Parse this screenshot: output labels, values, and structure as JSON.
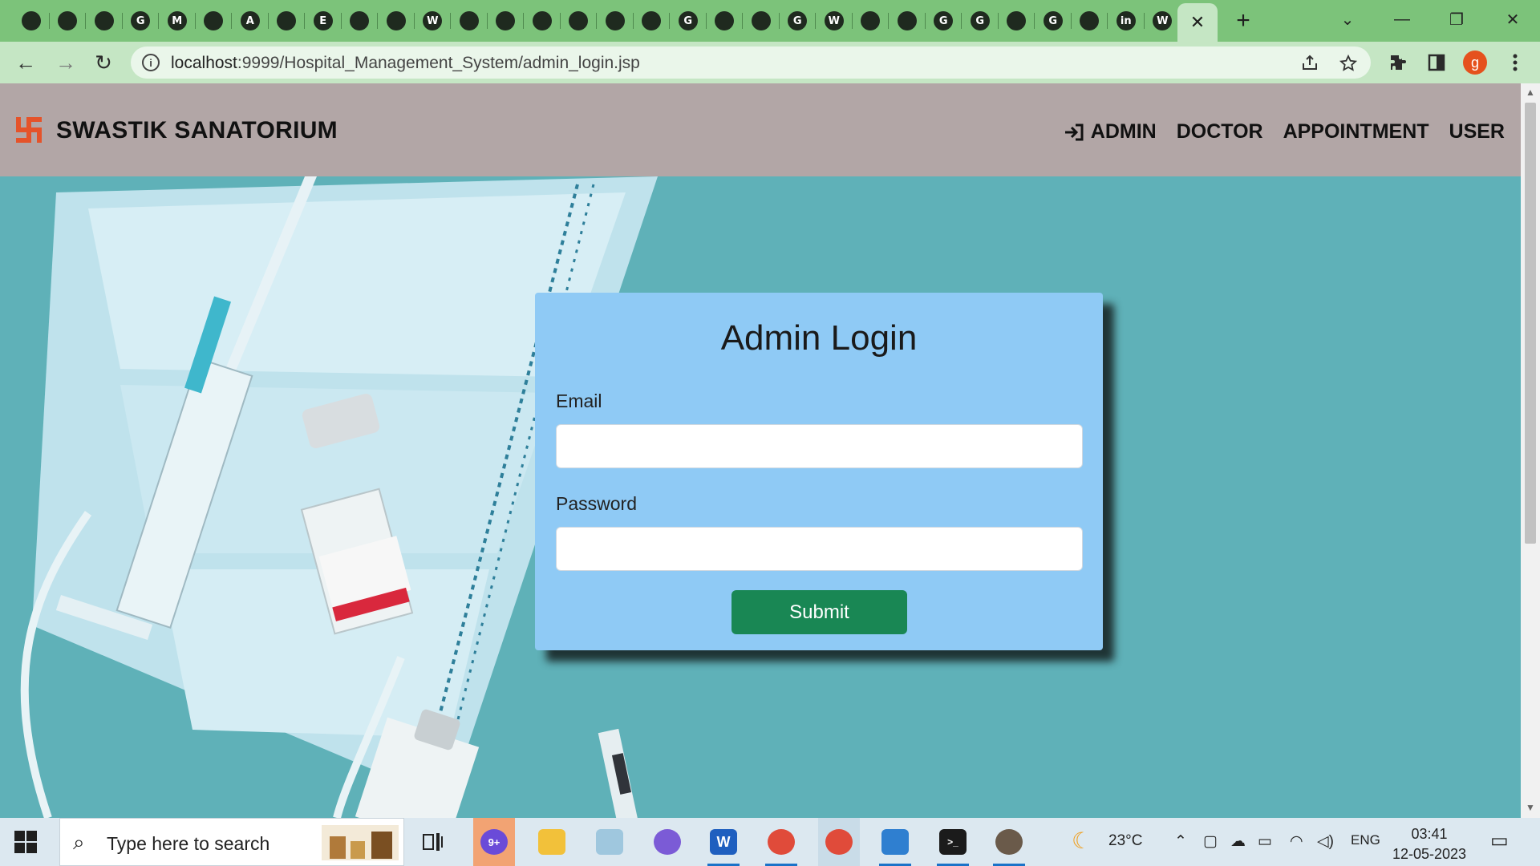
{
  "browser": {
    "tab_icon_letters": [
      "",
      "",
      "",
      "G",
      "M",
      "",
      "A",
      "",
      "E",
      "",
      "",
      "W",
      "",
      "",
      "",
      "",
      "",
      "",
      "G",
      "",
      "",
      "G",
      "W",
      "",
      "",
      "G",
      "G",
      "",
      "G",
      "",
      "in",
      "W"
    ],
    "active_tab_close": "✕",
    "new_tab": "+",
    "window_controls": [
      "⌄",
      "—",
      "❐",
      "✕"
    ],
    "nav": {
      "back": "←",
      "forward": "→",
      "reload": "↻"
    },
    "url_host": "localhost",
    "url_path": ":9999/Hospital_Management_System/admin_login.jsp",
    "avatar_letter": "g",
    "omnibox_icons": [
      "share-icon",
      "star-icon"
    ],
    "toolbar_icons": [
      "extensions-icon",
      "side-panel-icon",
      "menu-icon"
    ]
  },
  "site": {
    "brand": "SWASTIK SANATORIUM",
    "nav": {
      "admin": "ADMIN",
      "doctor": "DOCTOR",
      "appointment": "APPOINTMENT",
      "user": "USER"
    }
  },
  "login": {
    "title": "Admin Login",
    "email_label": "Email",
    "email_value": "",
    "password_label": "Password",
    "password_value": "",
    "submit_label": "Submit"
  },
  "taskbar": {
    "search_placeholder": "Type here to search",
    "weather": "23°C",
    "language": "ENG",
    "time": "03:41",
    "date": "12-05-2023"
  },
  "colors": {
    "tabstrip": "#7cc37a",
    "navrow": "#c5e6c4",
    "site_header": "#b2a6a6",
    "card": "#8fcaf5",
    "submit": "#198754",
    "background": "#5fb1b8"
  }
}
